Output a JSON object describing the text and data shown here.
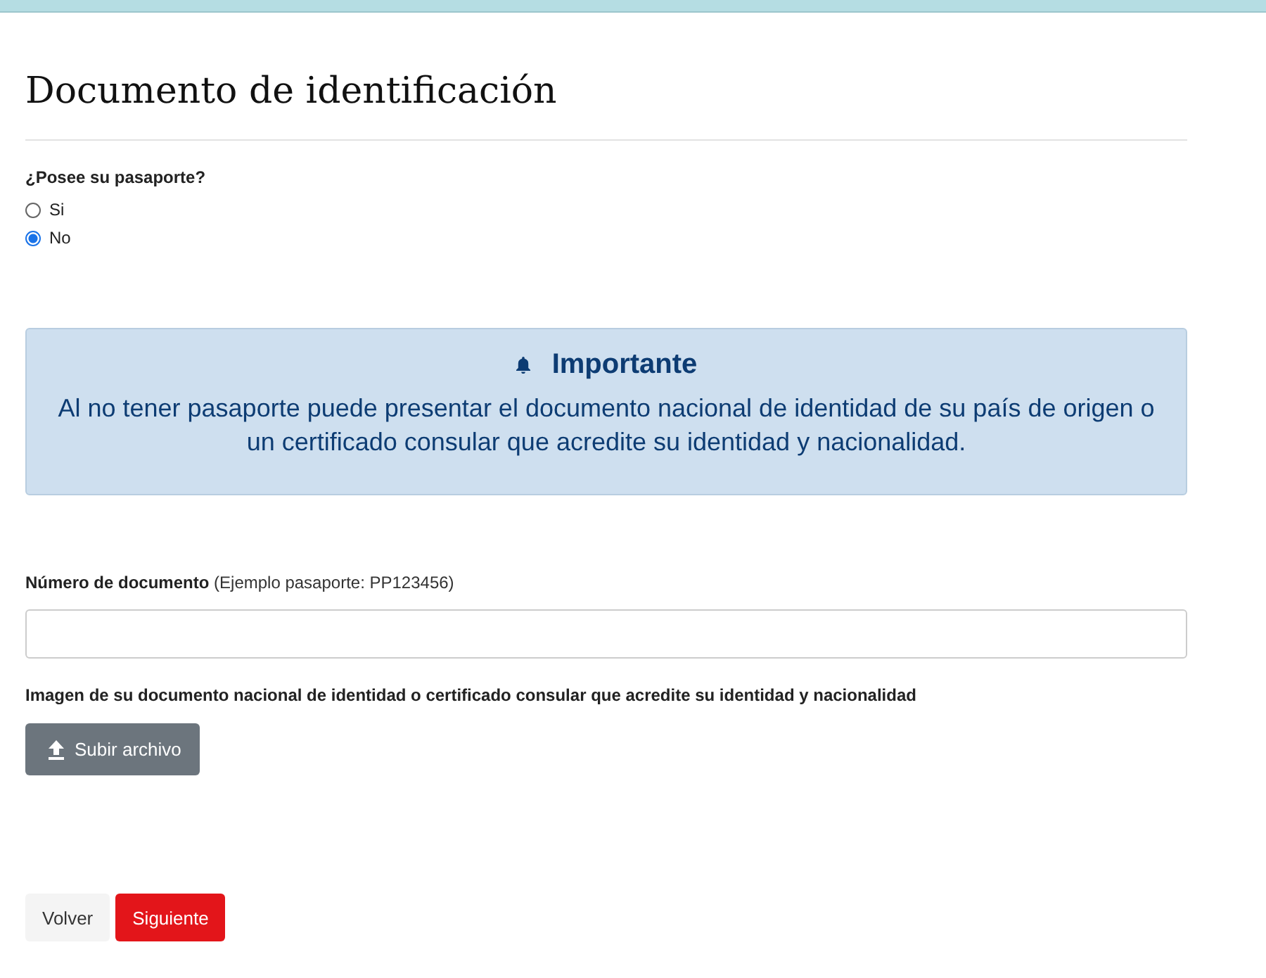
{
  "title": "Documento de identificación",
  "question": {
    "label": "¿Posee su pasaporte?",
    "options": [
      {
        "label": "Si",
        "selected": false
      },
      {
        "label": "No",
        "selected": true
      }
    ]
  },
  "alert": {
    "title": "Importante",
    "text": "Al no tener pasaporte puede presentar el documento nacional de identidad de su país de origen o un certificado consular que acredite su identidad y nacionalidad."
  },
  "document_number": {
    "label": "**Número de documento** (Ejemplo pasaporte: PP123456)"
  },
  "upload": {
    "label": "Imagen de su documento nacional de identidad o certificado consular que acredite su identidad y nacionalidad",
    "button": "Subir archivo"
  },
  "buttons": [
    {
      "label": "Volver",
      "kind": "secondary"
    },
    {
      "label": "Siguiente",
      "kind": "primary"
    }
  ]
}
